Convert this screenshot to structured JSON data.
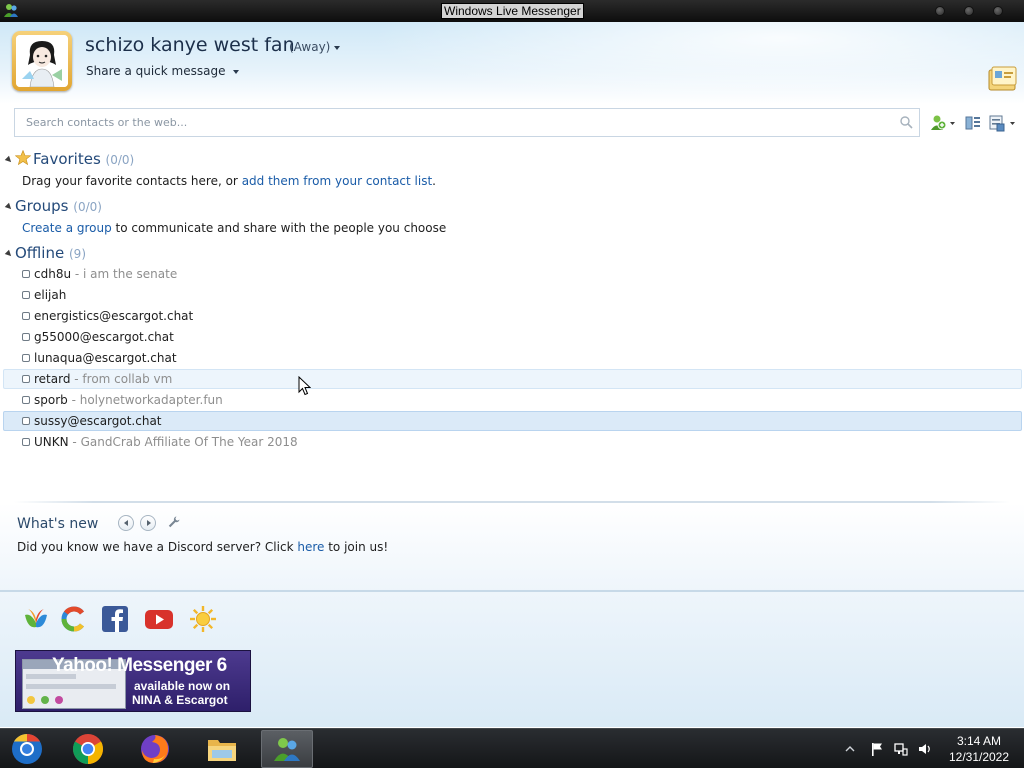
{
  "window": {
    "title": "Windows Live Messenger"
  },
  "profile": {
    "display_name": "schizo kanye west fan",
    "status": "(Away)",
    "quick_message": "Share a quick message"
  },
  "search": {
    "placeholder": "Search contacts or the web..."
  },
  "favorites": {
    "label": "Favorites",
    "count": "(0/0)",
    "note_prefix": "Drag your favorite contacts here, or ",
    "note_link": "add them from your contact list",
    "note_suffix": "."
  },
  "groups": {
    "label": "Groups",
    "count": "(0/0)",
    "note_link": "Create a group",
    "note_suffix": " to communicate and share with the people you choose"
  },
  "offline": {
    "label": "Offline",
    "count": "(9)",
    "contacts": [
      {
        "name": "cdh8u",
        "sep": " - ",
        "message": "i am the senate"
      },
      {
        "name": "elijah",
        "sep": "",
        "message": ""
      },
      {
        "name": "energistics@escargot.chat",
        "sep": "",
        "message": ""
      },
      {
        "name": "g55000@escargot.chat",
        "sep": "",
        "message": ""
      },
      {
        "name": "lunaqua@escargot.chat",
        "sep": "",
        "message": ""
      },
      {
        "name": "retard",
        "sep": " - ",
        "message": "from collab vm"
      },
      {
        "name": "sporb",
        "sep": " - ",
        "message": "holynetworkadapter.fun"
      },
      {
        "name": "sussy@escargot.chat",
        "sep": "",
        "message": ""
      },
      {
        "name": "UNKN",
        "sep": " - ",
        "message": "GandCrab Affiliate Of The Year 2018"
      }
    ]
  },
  "whats_new": {
    "title": "What's new",
    "text_prefix": "Did you know we have a Discord server? Click ",
    "text_link": "here",
    "text_suffix": " to join us!"
  },
  "services": [
    "msn-butterfly-icon",
    "windows-live-icon",
    "facebook-icon",
    "youtube-icon",
    "weather-sun-icon"
  ],
  "ad": {
    "line1": "Yahoo! Messenger 6",
    "line2": "available now on",
    "line3": "NINA & Escargot"
  },
  "taskbar": {
    "apps": [
      "chrome-logo-start",
      "google-chrome",
      "firefox",
      "file-explorer",
      "windows-live-messenger"
    ],
    "time": "3:14 AM",
    "date": "12/31/2022"
  }
}
